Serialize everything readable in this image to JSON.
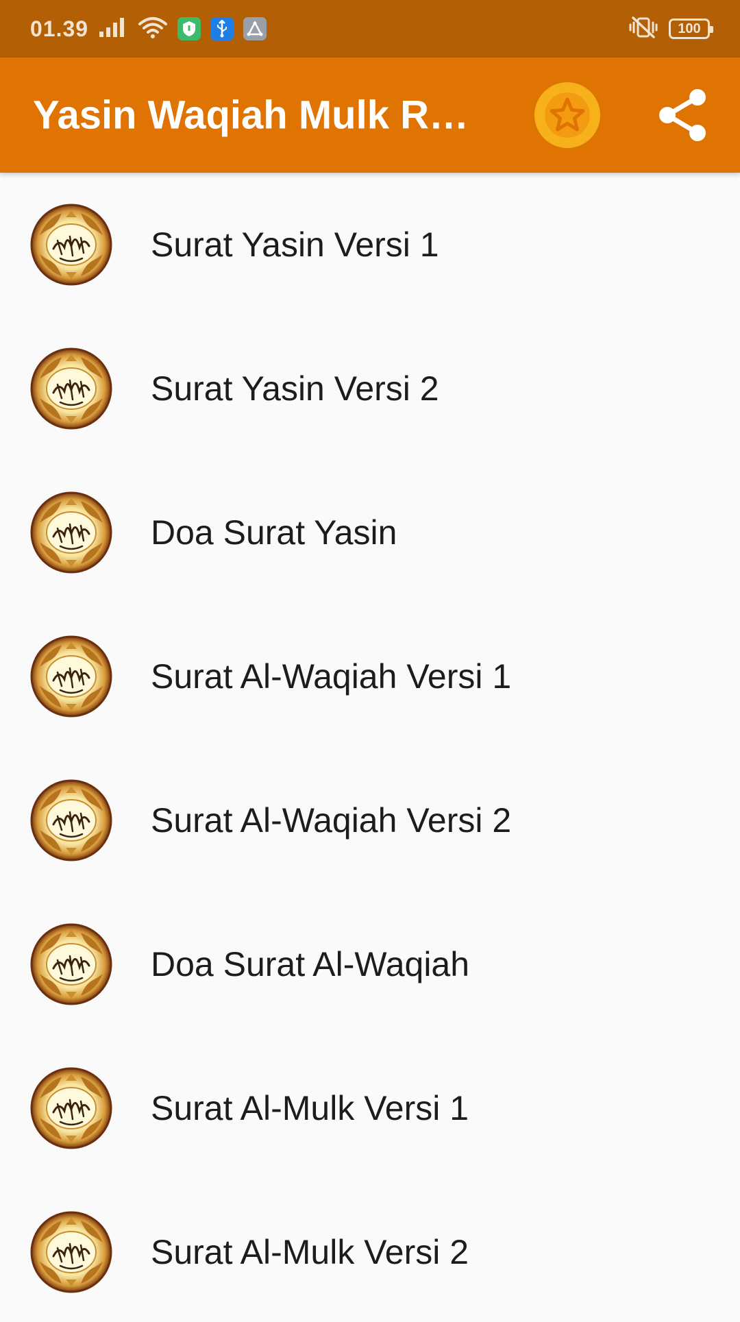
{
  "status_bar": {
    "time": "01.39",
    "battery": "100",
    "icons": [
      "signal-icon",
      "wifi-icon",
      "shield-notification-icon",
      "usb-notification-icon",
      "app-notification-icon",
      "vibrate-silent-icon",
      "battery-icon"
    ]
  },
  "app_bar": {
    "title": "Yasin Waqiah Mulk Rahman",
    "rate_icon": "star-icon",
    "share_icon": "share-icon"
  },
  "list": {
    "items": [
      {
        "label": "Surat Yasin Versi 1",
        "icon": "quran-emblem-icon"
      },
      {
        "label": "Surat Yasin Versi 2",
        "icon": "quran-emblem-icon"
      },
      {
        "label": "Doa Surat Yasin",
        "icon": "quran-emblem-icon"
      },
      {
        "label": "Surat Al-Waqiah Versi 1",
        "icon": "quran-emblem-icon"
      },
      {
        "label": "Surat Al-Waqiah Versi 2",
        "icon": "quran-emblem-icon"
      },
      {
        "label": "Doa Surat Al-Waqiah",
        "icon": "quran-emblem-icon"
      },
      {
        "label": "Surat Al-Mulk Versi 1",
        "icon": "quran-emblem-icon"
      },
      {
        "label": "Surat Al-Mulk Versi 2",
        "icon": "quran-emblem-icon"
      }
    ]
  },
  "colors": {
    "status_bar": "#b35f06",
    "app_bar": "#e07403",
    "star_button": "#f7b21b",
    "background": "#fafafa"
  }
}
